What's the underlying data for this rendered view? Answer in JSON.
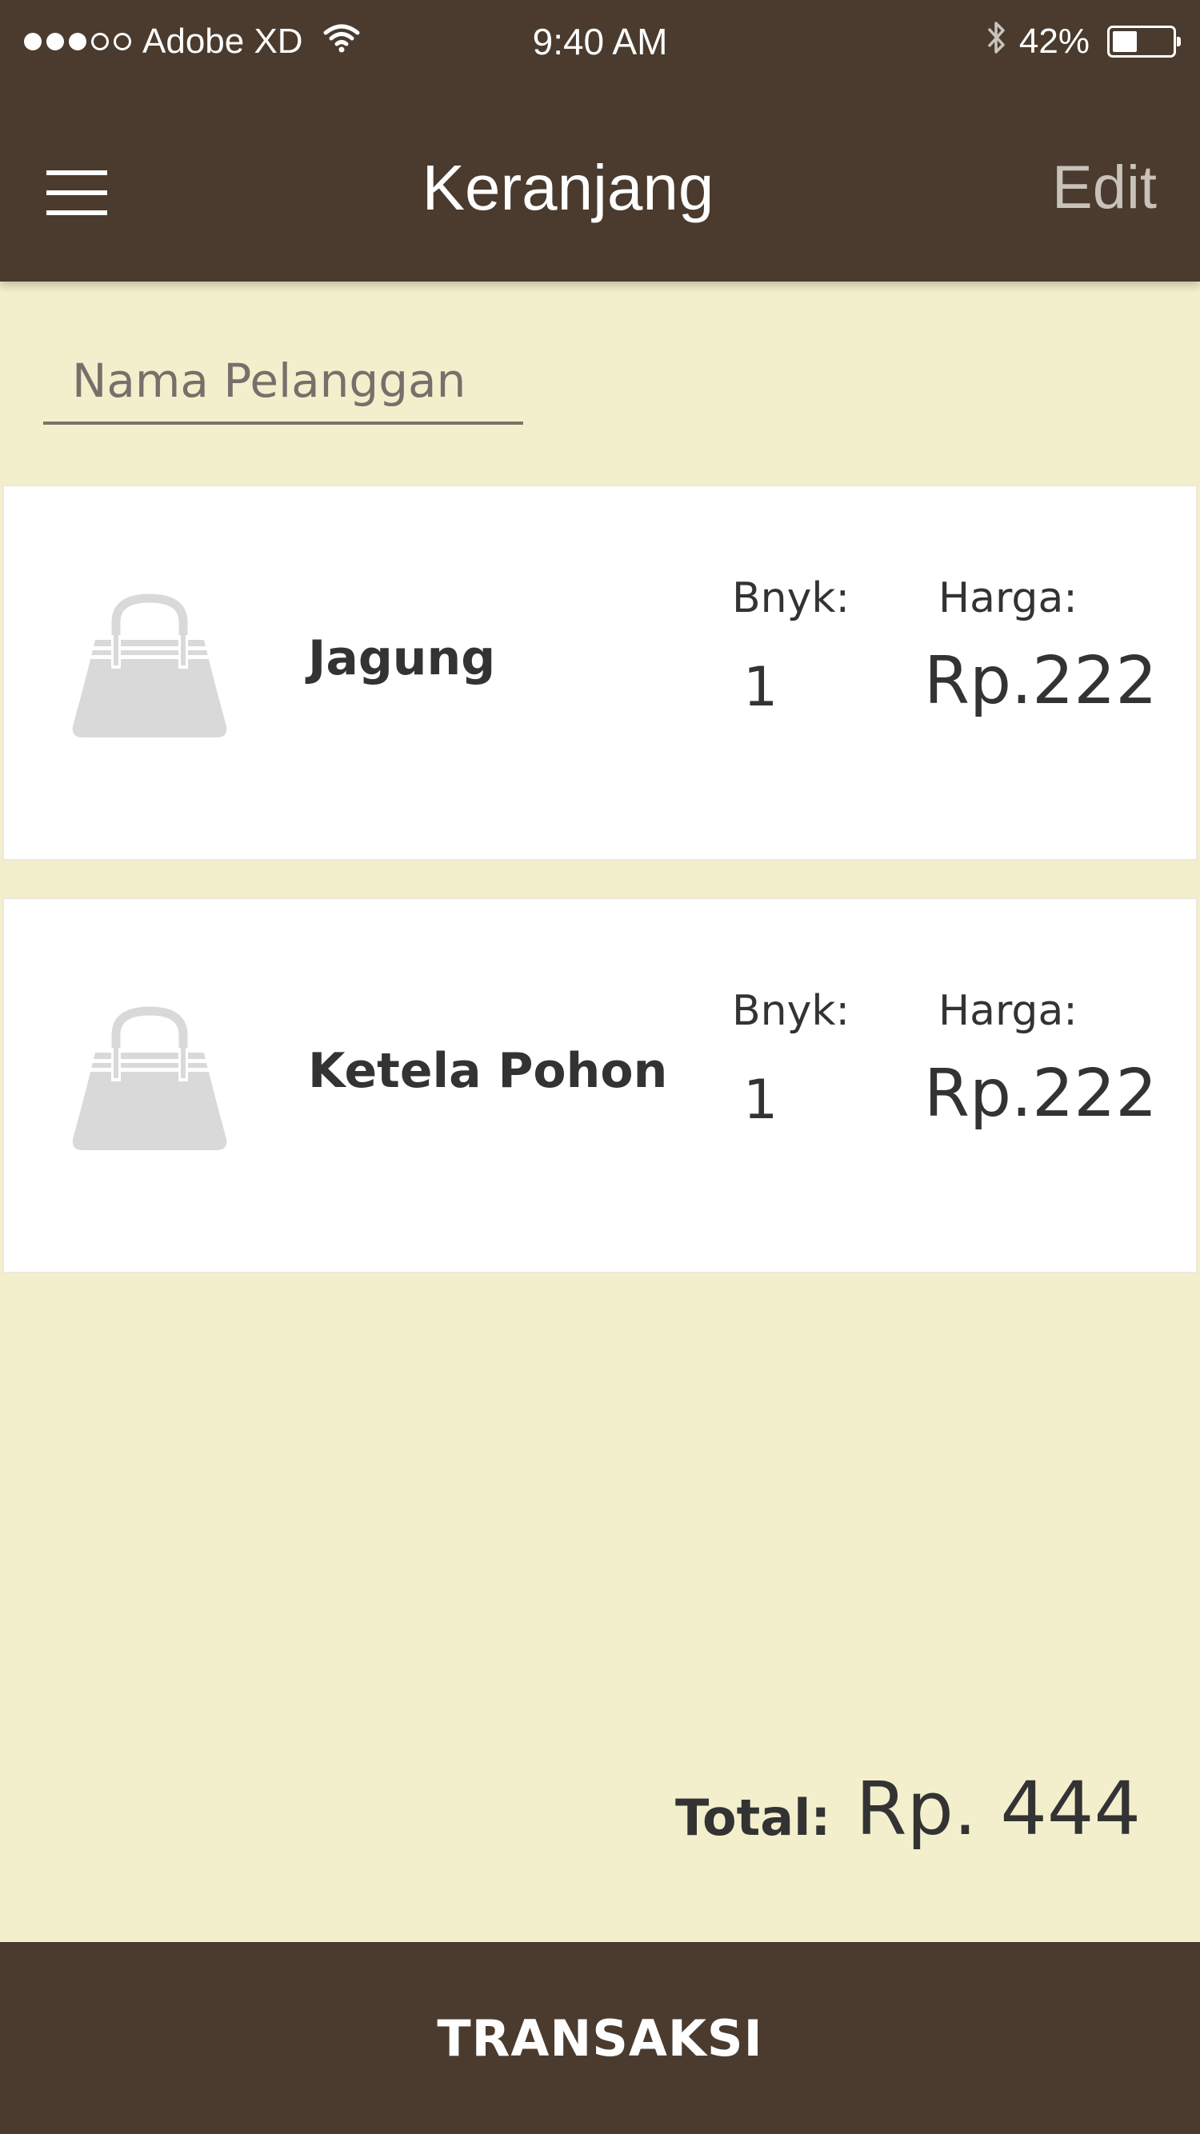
{
  "status_bar": {
    "carrier": "Adobe XD",
    "time": "9:40 AM",
    "battery": "42%",
    "battery_level": 0.42,
    "signal_bars_filled": 3,
    "signal_bars_total": 5
  },
  "nav": {
    "title": "Keranjang",
    "edit_label": "Edit"
  },
  "customer": {
    "placeholder": "Nama Pelanggan",
    "value": ""
  },
  "items": [
    {
      "name": "Jagung",
      "qty_label": "Bnyk:",
      "qty": "1",
      "price_label": "Harga:",
      "price": "Rp.222"
    },
    {
      "name": "Ketela Pohon",
      "qty_label": "Bnyk:",
      "qty": "1",
      "price_label": "Harga:",
      "price": "Rp.222"
    }
  ],
  "total": {
    "label": "Total:",
    "value": "Rp. 444"
  },
  "action": {
    "label": "TRANSAKSI"
  },
  "colors": {
    "header_bg": "#4a3b2e",
    "page_bg": "#f3efcc",
    "card_bg": "#ffffff",
    "bag_icon": "#d9d9d9",
    "edit_text": "#c8c2b8"
  }
}
